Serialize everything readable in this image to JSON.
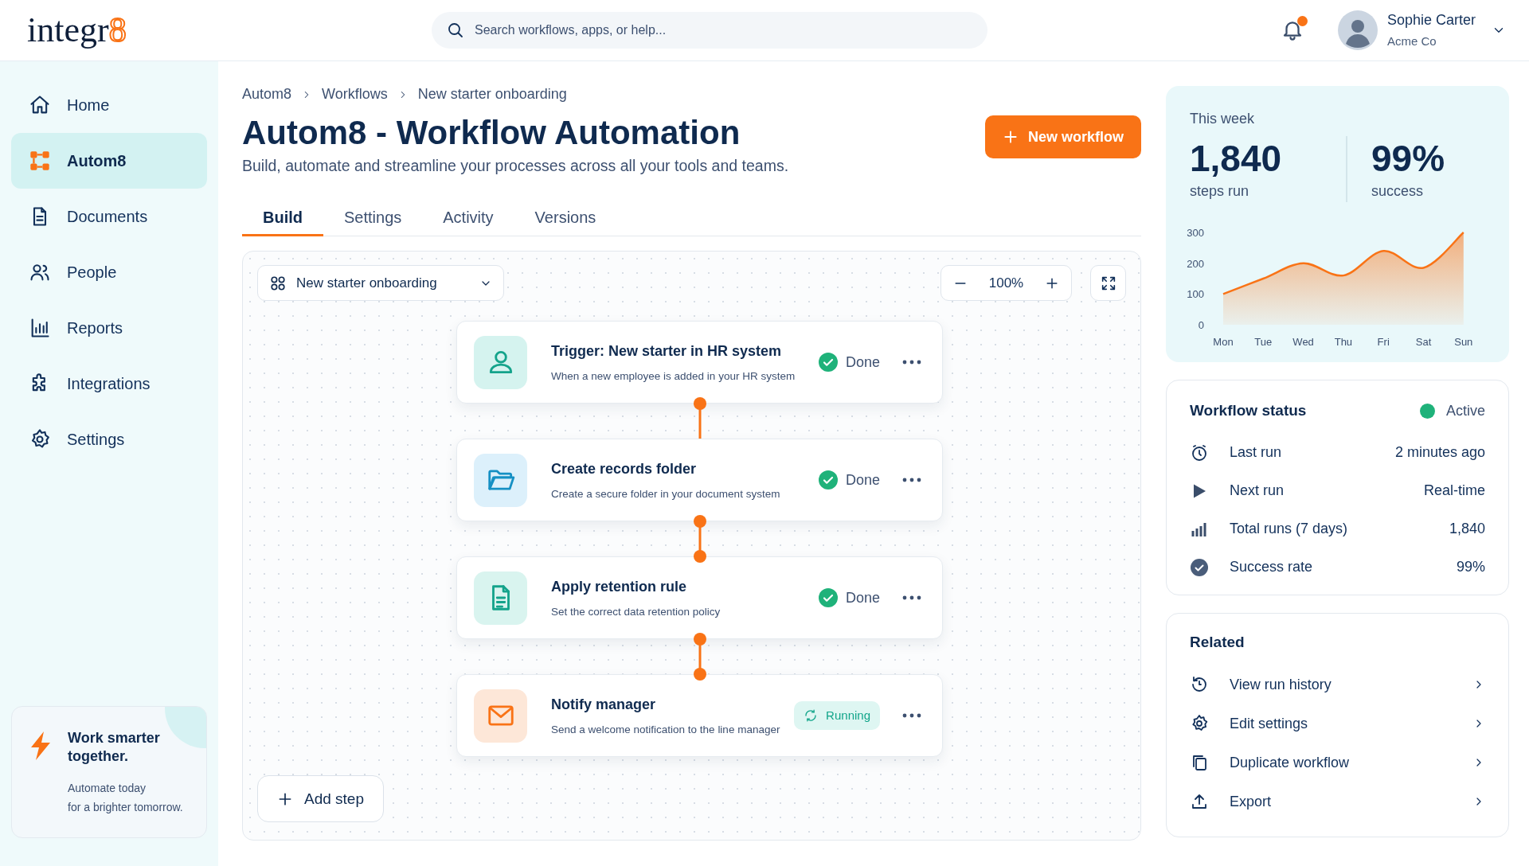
{
  "header": {
    "logo": {
      "text": "integr",
      "mark": "8"
    },
    "search": {
      "placeholder": "Search workflows, apps, or help..."
    },
    "notifications": {
      "unread": true
    },
    "user": {
      "name": "Sophie Carter",
      "company": "Acme Co"
    }
  },
  "sidebar": {
    "items": [
      {
        "label": "Home",
        "selected": false
      },
      {
        "label": "Autom8",
        "selected": true
      },
      {
        "label": "Documents",
        "selected": false
      },
      {
        "label": "People",
        "selected": false
      },
      {
        "label": "Reports",
        "selected": false
      },
      {
        "label": "Integrations",
        "selected": false
      },
      {
        "label": "Settings",
        "selected": false
      }
    ],
    "promo": {
      "title": "Work smarter together.",
      "text_lines": [
        "Automate today",
        "for a brighter tomorrow."
      ]
    }
  },
  "breadcrumb": [
    "Autom8",
    "Workflows",
    "New starter onboarding"
  ],
  "page": {
    "title": "Autom8 - Workflow Automation",
    "subtitle": "Build, automate and streamline your processes across all your tools and teams.",
    "new_button": "New workflow"
  },
  "tabs": [
    {
      "label": "Build",
      "selected": true
    },
    {
      "label": "Settings",
      "selected": false
    },
    {
      "label": "Activity",
      "selected": false
    },
    {
      "label": "Versions",
      "selected": false
    }
  ],
  "canvas": {
    "workflow_select": "New starter onboarding",
    "zoom": "100%",
    "add_step": "Add step",
    "steps": [
      {
        "title": "Trigger: New starter in HR system",
        "description": "When a new employee is added in your HR system",
        "status": {
          "kind": "done",
          "label": "Done"
        }
      },
      {
        "title": "Create records folder",
        "description": "Create a secure folder in your document system",
        "status": {
          "kind": "done",
          "label": "Done"
        }
      },
      {
        "title": "Apply retention rule",
        "description": "Set the correct data retention policy",
        "status": {
          "kind": "done",
          "label": "Done"
        }
      },
      {
        "title": "Notify manager",
        "description": "Send a welcome notification to the line manager",
        "status": {
          "kind": "running",
          "label": "Running"
        }
      }
    ]
  },
  "stats": {
    "period": "This week",
    "metrics": [
      {
        "value": "1,840",
        "label": "steps run"
      },
      {
        "value": "99%",
        "label": "success"
      }
    ],
    "chart_data": {
      "type": "area",
      "categories": [
        "Mon",
        "Tue",
        "Wed",
        "Thu",
        "Fri",
        "Sat",
        "Sun"
      ],
      "series": [
        {
          "color": "#f97316",
          "values": [
            100,
            150,
            200,
            160,
            240,
            185,
            300
          ]
        }
      ],
      "ylim": [
        0,
        300
      ],
      "yticks": [
        0,
        100,
        200,
        300
      ]
    }
  },
  "workflow_status": {
    "title": "Workflow status",
    "state": {
      "label": "Active",
      "color": "#1fb27a"
    },
    "rows": [
      {
        "label": "Last run",
        "value": "2 minutes ago"
      },
      {
        "label": "Next run",
        "value": "Real-time"
      },
      {
        "label": "Total runs (7 days)",
        "value": "1,840"
      },
      {
        "label": "Success rate",
        "value": "99%"
      }
    ]
  },
  "related": {
    "title": "Related",
    "items": [
      {
        "label": "View run history"
      },
      {
        "label": "Edit settings"
      },
      {
        "label": "Duplicate workflow"
      },
      {
        "label": "Export"
      }
    ]
  }
}
